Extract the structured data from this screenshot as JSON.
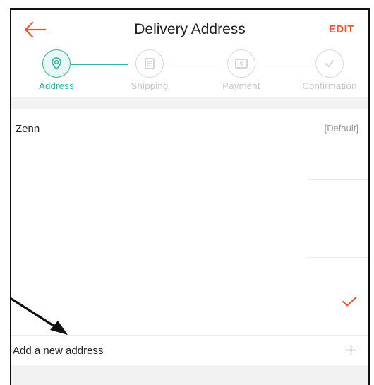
{
  "header": {
    "title": "Delivery Address",
    "edit_label": "EDIT"
  },
  "stepper": {
    "steps": [
      {
        "label": "Address",
        "icon": "location-pin-icon",
        "active": true
      },
      {
        "label": "Shipping",
        "icon": "document-icon",
        "active": false
      },
      {
        "label": "Payment",
        "icon": "money-icon",
        "active": false
      },
      {
        "label": "Confirmation",
        "icon": "check-icon",
        "active": false
      }
    ]
  },
  "address": {
    "name": "Zenn",
    "default_tag": "[Default]",
    "selected": true
  },
  "add_address": {
    "label": "Add a new address"
  },
  "colors": {
    "accent": "#f0522a",
    "step_active": "#2bb7a2",
    "step_inactive": "#c4c4c4",
    "gray_bg": "#f2f2f2"
  }
}
